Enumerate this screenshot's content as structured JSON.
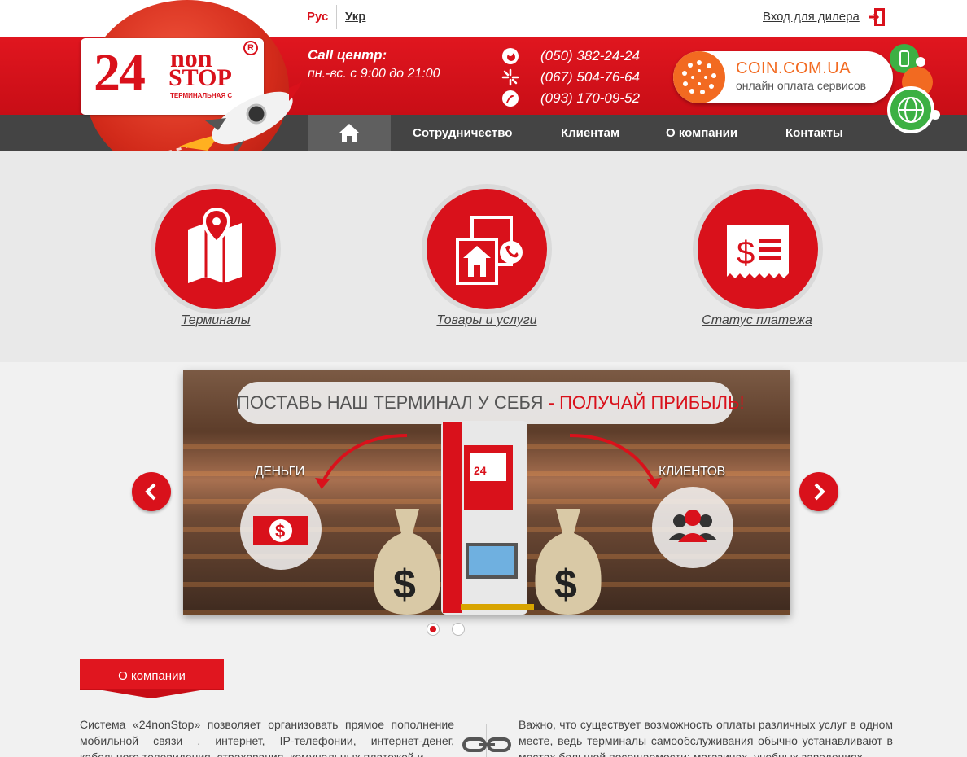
{
  "header": {
    "lang_ru": "Рус",
    "lang_uk": "Укр",
    "dealer_login": "Вход для дилера"
  },
  "logo": {
    "number": "24",
    "non": "non",
    "stop": "STOP",
    "registered": "R",
    "subtitle": "ТЕРМИНАЛЬНАЯ С"
  },
  "call_center": {
    "title": "Call центр:",
    "hours": "пн.-вс. с 9:00 до 21:00",
    "phones": [
      {
        "number": "(050) 382-24-24",
        "operator_icon": "vodafone-icon"
      },
      {
        "number": "(067) 504-76-64",
        "operator_icon": "kyivstar-icon"
      },
      {
        "number": "(093) 170-09-52",
        "operator_icon": "lifecell-icon"
      }
    ]
  },
  "coin_banner": {
    "title": "COIN.COM.UA",
    "subtitle": "онлайн оплата сервисов"
  },
  "nav": {
    "home_icon": "home-icon",
    "items": [
      "Сотрудничество",
      "Клиентам",
      "О компании",
      "Контакты"
    ]
  },
  "services": [
    {
      "label": "Терминалы",
      "icon": "map-pin-icon"
    },
    {
      "label": "Товары и услуги",
      "icon": "goods-services-icon"
    },
    {
      "label": "Статус платежа",
      "icon": "receipt-icon"
    }
  ],
  "slider": {
    "headline_part1": "ПОСТАВЬ НАШ ТЕРМИНАЛ У СЕБЯ",
    "headline_dash": " - ",
    "headline_part2": "ПОЛУЧАЙ ПРИБЫЛЬ!",
    "left_label": "ДЕНЬГИ",
    "right_label": "КЛИЕНТОВ",
    "terminal_badge": "24",
    "slides_count": 2,
    "active_slide": 1
  },
  "about": {
    "title": "О компании",
    "left_text": "Система «24nonStop» позволяет организовать прямое пополнение мобильной связи , интернет, IP-телефонии, интернет-денег, кабельного телевидения, страхования, комунальных платежей и",
    "right_text": "Важно, что существует возможность оплаты различных услуг в одном месте, ведь терминалы самообслуживания обычно устанавливают в местах большой посещаемости: магазинах, учебных заведениях"
  },
  "colors": {
    "brand_red": "#d9111b",
    "nav_dark": "#444444",
    "coin_orange": "#f26a21"
  }
}
